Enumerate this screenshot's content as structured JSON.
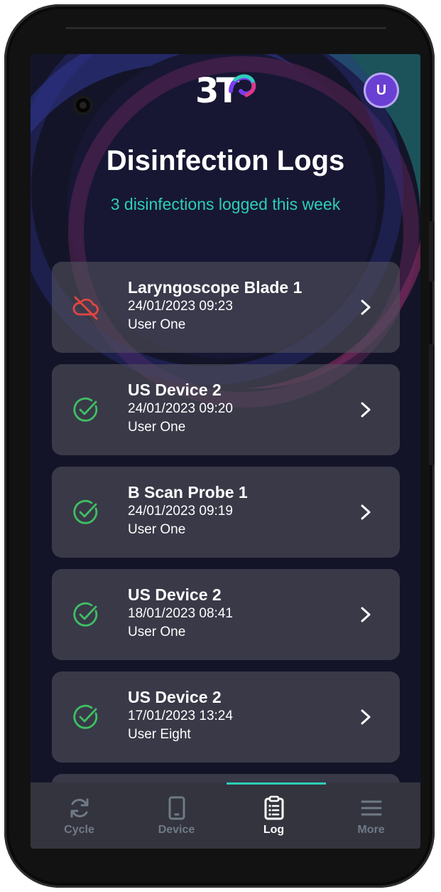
{
  "app": {
    "logo_text": "3T",
    "avatar_initial": "U"
  },
  "header": {
    "title": "Disinfection Logs",
    "subtitle": "3 disinfections logged this week"
  },
  "logs": [
    {
      "device": "Laryngoscope Blade 1",
      "datetime": "24/01/2023 09:23",
      "user": "User One",
      "status": "failed",
      "status_icon": "cloud-off-icon",
      "status_color": "#e2463f"
    },
    {
      "device": "US Device 2",
      "datetime": "24/01/2023 09:20",
      "user": "User One",
      "status": "passed",
      "status_icon": "check-circle-icon",
      "status_color": "#3fbf62"
    },
    {
      "device": "B Scan Probe 1",
      "datetime": "24/01/2023 09:19",
      "user": "User One",
      "status": "passed",
      "status_icon": "check-circle-icon",
      "status_color": "#3fbf62"
    },
    {
      "device": "US Device 2",
      "datetime": "18/01/2023 08:41",
      "user": "User One",
      "status": "passed",
      "status_icon": "check-circle-icon",
      "status_color": "#3fbf62"
    },
    {
      "device": "US Device 2",
      "datetime": "17/01/2023 13:24",
      "user": "User Eight",
      "status": "passed",
      "status_icon": "check-circle-icon",
      "status_color": "#3fbf62"
    }
  ],
  "nav": {
    "items": [
      {
        "label": "Cycle",
        "icon": "refresh-icon",
        "active": false
      },
      {
        "label": "Device",
        "icon": "tablet-icon",
        "active": false
      },
      {
        "label": "Log",
        "icon": "clipboard-list-icon",
        "active": true
      },
      {
        "label": "More",
        "icon": "menu-icon",
        "active": false
      }
    ],
    "accent_color": "#2ccfb7"
  },
  "colors": {
    "background": "#141429",
    "accent": "#2ccfb7",
    "card": "#4b4b56",
    "navbar": "#34343f"
  }
}
